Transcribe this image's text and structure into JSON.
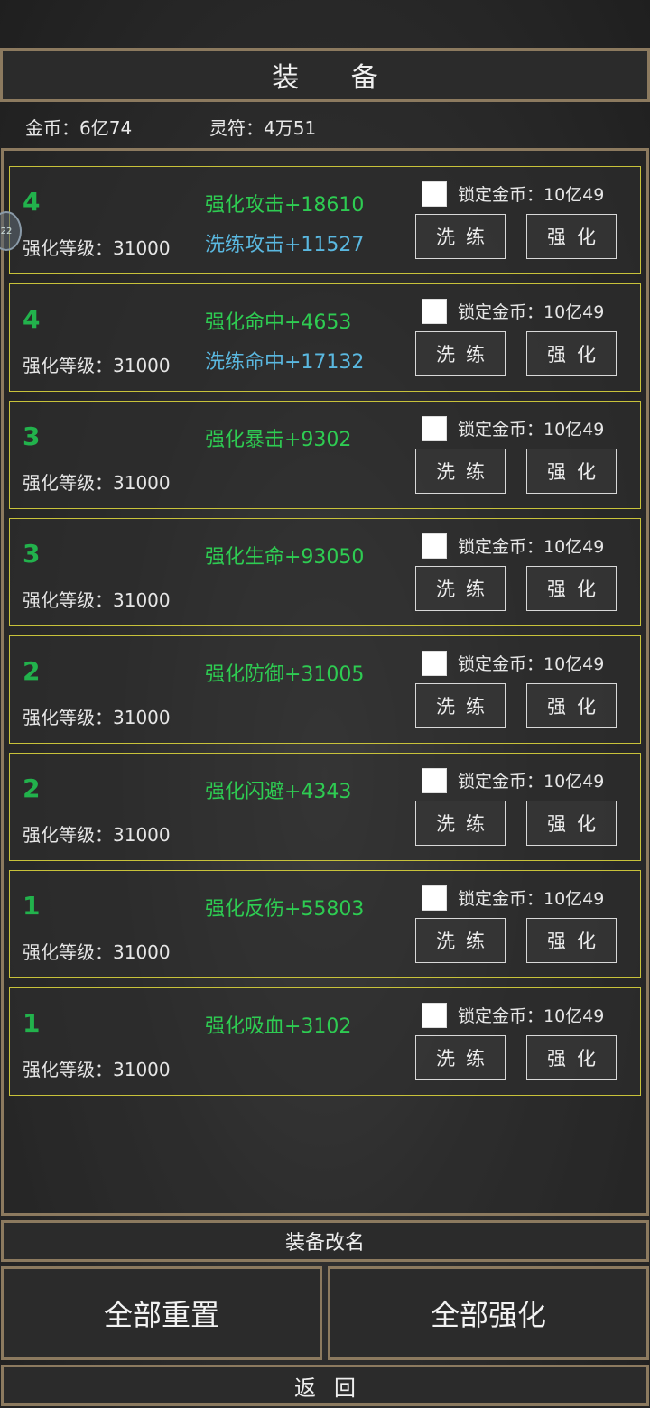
{
  "header": {
    "title": "装 备"
  },
  "currency": {
    "gold": "金币：6亿74",
    "rune": "灵符：4万51"
  },
  "side_bubble": "22",
  "cards": [
    {
      "tier": "4",
      "level": "强化等级：31000",
      "stat1": "强化攻击+18610",
      "stat2": "洗练攻击+11527",
      "lock": "锁定金币：10亿49",
      "refine": "洗练",
      "enhance": "强化"
    },
    {
      "tier": "4",
      "level": "强化等级：31000",
      "stat1": "强化命中+4653",
      "stat2": "洗练命中+17132",
      "lock": "锁定金币：10亿49",
      "refine": "洗练",
      "enhance": "强化"
    },
    {
      "tier": "3",
      "level": "强化等级：31000",
      "stat1": "强化暴击+9302",
      "stat2": "",
      "lock": "锁定金币：10亿49",
      "refine": "洗练",
      "enhance": "强化"
    },
    {
      "tier": "3",
      "level": "强化等级：31000",
      "stat1": "强化生命+93050",
      "stat2": "",
      "lock": "锁定金币：10亿49",
      "refine": "洗练",
      "enhance": "强化"
    },
    {
      "tier": "2",
      "level": "强化等级：31000",
      "stat1": "强化防御+31005",
      "stat2": "",
      "lock": "锁定金币：10亿49",
      "refine": "洗练",
      "enhance": "强化"
    },
    {
      "tier": "2",
      "level": "强化等级：31000",
      "stat1": "强化闪避+4343",
      "stat2": "",
      "lock": "锁定金币：10亿49",
      "refine": "洗练",
      "enhance": "强化"
    },
    {
      "tier": "1",
      "level": "强化等级：31000",
      "stat1": "强化反伤+55803",
      "stat2": "",
      "lock": "锁定金币：10亿49",
      "refine": "洗练",
      "enhance": "强化"
    },
    {
      "tier": "1",
      "level": "强化等级：31000",
      "stat1": "强化吸血+3102",
      "stat2": "",
      "lock": "锁定金币：10亿49",
      "refine": "洗练",
      "enhance": "强化"
    }
  ],
  "footer": {
    "rename": "装备改名",
    "reset_all": "全部重置",
    "enhance_all": "全部强化",
    "back": "返回"
  },
  "colors": {
    "frame": "#8c7a5f",
    "card_border": "#c8c23a",
    "enhance_stat": "#2ecc52",
    "refine_stat": "#5ab8e0",
    "tier": "#22b24c"
  }
}
